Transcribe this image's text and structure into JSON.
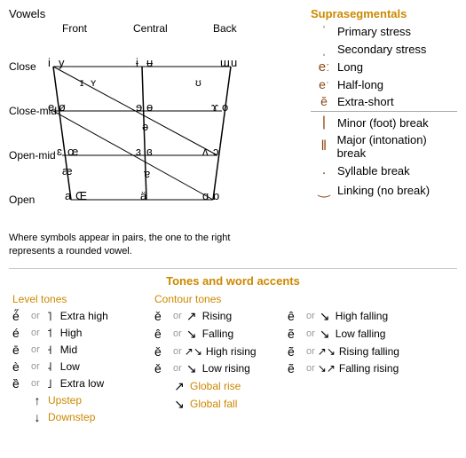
{
  "vowels": {
    "title": "Vowels",
    "columns": [
      "Front",
      "Central",
      "Back"
    ],
    "rows": [
      "Close",
      "Close-mid",
      "Open-mid",
      "Open"
    ],
    "note": "Where symbols appear in pairs, the one to the right represents a rounded vowel."
  },
  "suprasegmentals": {
    "title": "Suprasegmentals",
    "items": [
      {
        "symbol": "ˈ",
        "label": "Primary stress"
      },
      {
        "symbol": "ˌ",
        "label": "Secondary stress"
      },
      {
        "symbol": "eː",
        "label": "Long"
      },
      {
        "symbol": "eˑ",
        "label": "Half-long"
      },
      {
        "symbol": "ě",
        "label": "Extra-short"
      },
      {
        "symbol": "|",
        "label": "Minor (foot) break"
      },
      {
        "symbol": "‖",
        "label": "Major (intonation) break"
      },
      {
        "symbol": ".",
        "label": "Syllable break"
      },
      {
        "symbol": "‿",
        "label": "Linking (no break)"
      }
    ]
  },
  "tones": {
    "title": "Tones and word accents",
    "level_title": "Level tones",
    "contour_title": "Contour tones",
    "level_items": [
      {
        "char": "é̋",
        "arrow": "˥",
        "label": "Extra high"
      },
      {
        "char": "é",
        "arrow": "˦",
        "label": "High"
      },
      {
        "char": "ē",
        "arrow": "˧",
        "label": "Mid"
      },
      {
        "char": "è",
        "arrow": "˨",
        "label": "Low"
      },
      {
        "char": "ȅ",
        "arrow": "˩",
        "label": "Extra low"
      }
    ],
    "level_extra": [
      {
        "arrow": "↑",
        "label": "Upstep"
      },
      {
        "arrow": "↓",
        "label": "Downstep"
      }
    ],
    "contour_items": [
      {
        "char": "ě",
        "arrow": "↗",
        "label": "Rising"
      },
      {
        "char": "ê",
        "arrow": "↘",
        "label": "Falling"
      },
      {
        "char": "ě",
        "arrow": "↗↘",
        "label": "High rising"
      },
      {
        "char": "ě",
        "arrow": "↘",
        "label": "Low rising"
      }
    ],
    "contour_right": [
      {
        "char": "ê",
        "arrow": "↘",
        "label": "High falling"
      },
      {
        "char": "ẽ",
        "arrow": "↘",
        "label": "Low falling"
      },
      {
        "char": "ẽ",
        "arrow": "↗↘",
        "label": "Rising falling"
      },
      {
        "char": "ẽ",
        "arrow": "↘↗",
        "label": "Falling rising"
      },
      {
        "arrow": "↗",
        "label": "Global rise"
      },
      {
        "arrow": "↘",
        "label": "Global fall"
      }
    ]
  }
}
